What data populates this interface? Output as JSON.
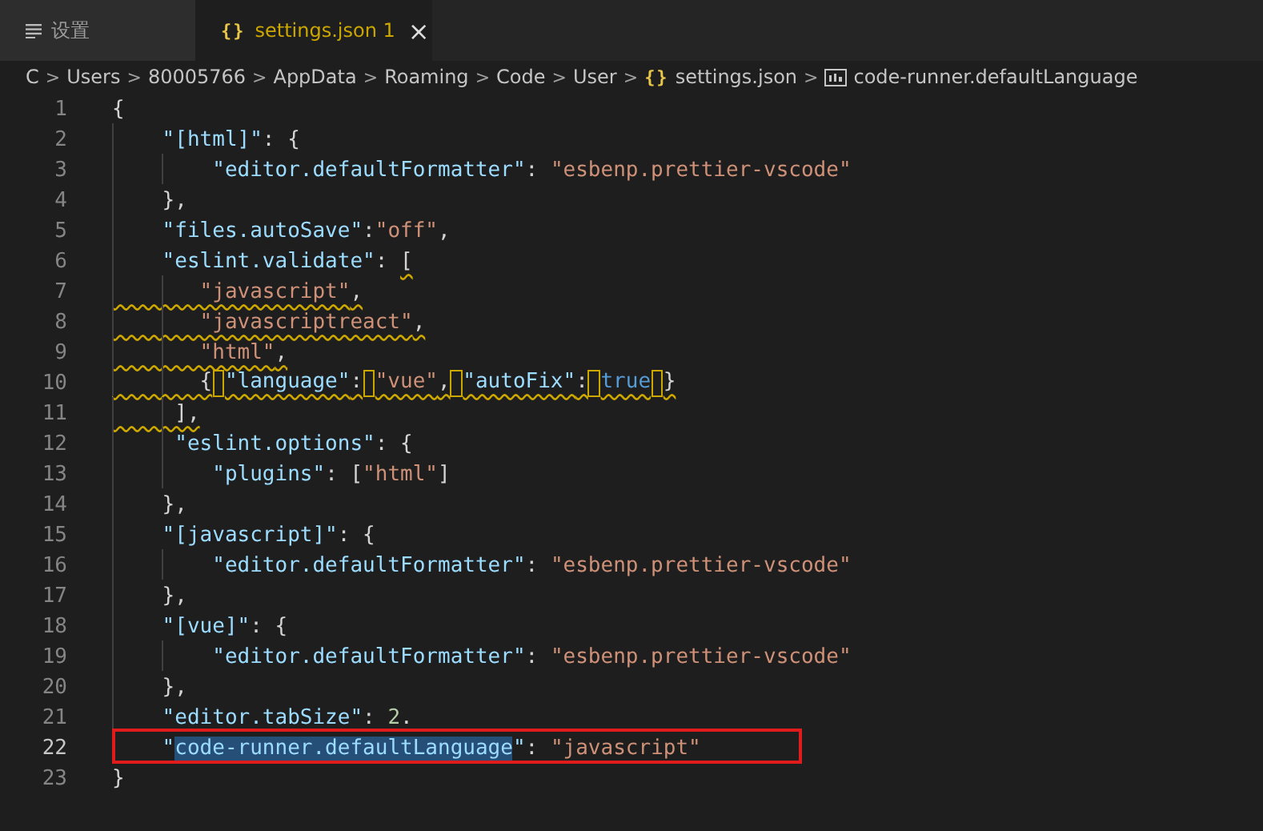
{
  "tabs": [
    {
      "kind": "settings",
      "label": "设置",
      "selected": false,
      "warning": false
    },
    {
      "kind": "file",
      "icon_glyph": "{}",
      "label": "settings.json",
      "badge": "1",
      "warning": true,
      "selected": true,
      "close": "×"
    }
  ],
  "breadcrumb": [
    {
      "kind": "folder",
      "label": "C"
    },
    {
      "kind": "folder",
      "label": "Users"
    },
    {
      "kind": "folder",
      "label": "80005766"
    },
    {
      "kind": "folder",
      "label": "AppData"
    },
    {
      "kind": "folder",
      "label": "Roaming"
    },
    {
      "kind": "folder",
      "label": "Code"
    },
    {
      "kind": "folder",
      "label": "User"
    },
    {
      "kind": "file",
      "label": "settings.json",
      "icon_glyph": "{}"
    },
    {
      "kind": "symbol",
      "label": "code-runner.defaultLanguage"
    }
  ],
  "separator": ">",
  "editor": {
    "lines": [
      {
        "number": "1",
        "tokens": [
          {
            "kind": "punct",
            "text": "{"
          }
        ]
      },
      {
        "number": "2",
        "tokens": [
          {
            "kind": "key",
            "text": "    \"[html]\""
          },
          {
            "kind": "punct",
            "text": ": {"
          }
        ]
      },
      {
        "number": "3",
        "tokens": [
          {
            "kind": "key",
            "text": "        \"editor.defaultFormatter\""
          },
          {
            "kind": "punct",
            "text": ": "
          },
          {
            "kind": "string",
            "text": "\"esbenp.prettier-vscode\""
          }
        ]
      },
      {
        "number": "4",
        "tokens": [
          {
            "kind": "punct",
            "text": "    },"
          }
        ]
      },
      {
        "number": "5",
        "tokens": [
          {
            "kind": "key",
            "text": "    \"files.autoSave\""
          },
          {
            "kind": "punct",
            "text": ":"
          },
          {
            "kind": "string",
            "text": "\"off\""
          },
          {
            "kind": "punct",
            "text": ","
          }
        ]
      },
      {
        "number": "6",
        "tokens": [
          {
            "kind": "key",
            "text": "    \"eslint.validate\""
          },
          {
            "kind": "punct",
            "text": ": "
          },
          {
            "kind": "punct",
            "text": "[",
            "warning": true
          }
        ]
      },
      {
        "number": "7",
        "warning": true,
        "tokens": [
          {
            "kind": "string",
            "text": "       \"javascript\""
          },
          {
            "kind": "punct",
            "text": ","
          }
        ]
      },
      {
        "number": "8",
        "warning": true,
        "tokens": [
          {
            "kind": "string",
            "text": "       \"javascriptreact\""
          },
          {
            "kind": "punct",
            "text": ","
          }
        ]
      },
      {
        "number": "9",
        "warning": true,
        "tokens": [
          {
            "kind": "string",
            "text": "       \"html\""
          },
          {
            "kind": "punct",
            "text": ","
          }
        ]
      },
      {
        "number": "10",
        "warning": true,
        "tokens": [
          {
            "kind": "punct",
            "text": "       {"
          },
          {
            "kind": "key",
            "text": "\"language\"",
            "space_before": true
          },
          {
            "kind": "punct",
            "text": ":"
          },
          {
            "kind": "string",
            "text": "\"vue\"",
            "space_before": true
          },
          {
            "kind": "punct",
            "text": ","
          },
          {
            "kind": "key",
            "text": "\"autoFix\"",
            "space_before": true
          },
          {
            "kind": "punct",
            "text": ":"
          },
          {
            "kind": "keyword",
            "text": "true",
            "space_before": true
          },
          {
            "kind": "punct",
            "text": "}",
            "space_before": true
          }
        ]
      },
      {
        "number": "11",
        "warning": true,
        "tokens": [
          {
            "kind": "punct",
            "text": "     ],"
          }
        ]
      },
      {
        "number": "12",
        "tokens": [
          {
            "kind": "key",
            "text": "     \"eslint.options\""
          },
          {
            "kind": "punct",
            "text": ": {"
          }
        ]
      },
      {
        "number": "13",
        "tokens": [
          {
            "kind": "key",
            "text": "        \"plugins\""
          },
          {
            "kind": "punct",
            "text": ": ["
          },
          {
            "kind": "string",
            "text": "\"html\""
          },
          {
            "kind": "punct",
            "text": "]"
          }
        ]
      },
      {
        "number": "14",
        "tokens": [
          {
            "kind": "punct",
            "text": "    },"
          }
        ]
      },
      {
        "number": "15",
        "tokens": [
          {
            "kind": "key",
            "text": "    \"[javascript]\""
          },
          {
            "kind": "punct",
            "text": ": {"
          }
        ]
      },
      {
        "number": "16",
        "tokens": [
          {
            "kind": "key",
            "text": "        \"editor.defaultFormatter\""
          },
          {
            "kind": "punct",
            "text": ": "
          },
          {
            "kind": "string",
            "text": "\"esbenp.prettier-vscode\""
          }
        ]
      },
      {
        "number": "17",
        "tokens": [
          {
            "kind": "punct",
            "text": "    },"
          }
        ]
      },
      {
        "number": "18",
        "tokens": [
          {
            "kind": "key",
            "text": "    \"[vue]\""
          },
          {
            "kind": "punct",
            "text": ": {"
          }
        ]
      },
      {
        "number": "19",
        "tokens": [
          {
            "kind": "key",
            "text": "        \"editor.defaultFormatter\""
          },
          {
            "kind": "punct",
            "text": ": "
          },
          {
            "kind": "string",
            "text": "\"esbenp.prettier-vscode\""
          }
        ]
      },
      {
        "number": "20",
        "tokens": [
          {
            "kind": "punct",
            "text": "    },"
          }
        ]
      },
      {
        "number": "21",
        "tokens": [
          {
            "kind": "key",
            "text": "    \"editor.tabSize\""
          },
          {
            "kind": "punct",
            "text": ": "
          },
          {
            "kind": "number",
            "text": "2"
          },
          {
            "kind": "punct",
            "text": "."
          }
        ]
      },
      {
        "number": "22",
        "current": true,
        "highlighted": true,
        "tokens": [
          {
            "kind": "key",
            "text": "    \""
          },
          {
            "kind": "key",
            "text": "code-runner.defaultLanguage",
            "selected": true
          },
          {
            "kind": "key",
            "text": "\""
          },
          {
            "kind": "punct",
            "text": ": "
          },
          {
            "kind": "string",
            "text": "\"javascript\""
          }
        ]
      },
      {
        "number": "23",
        "tokens": [
          {
            "kind": "punct",
            "text": "}"
          }
        ]
      }
    ]
  }
}
